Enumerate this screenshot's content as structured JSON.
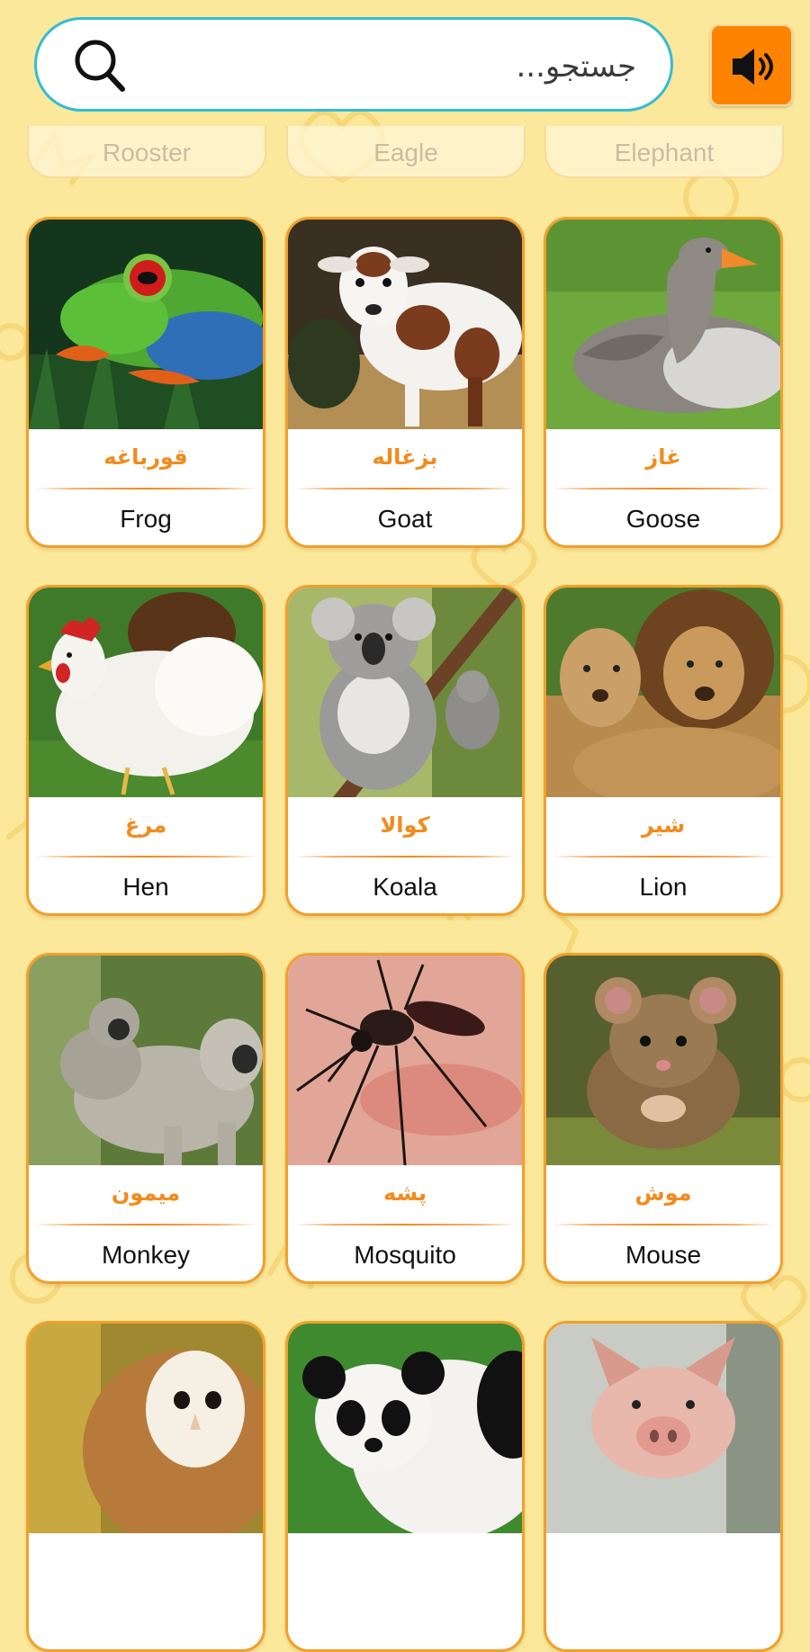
{
  "search": {
    "placeholder": "جستجو..."
  },
  "sound": {
    "icon": "speaker-icon",
    "bg": "#fd8300"
  },
  "colors": {
    "background": "#fbe89a",
    "accent": "#f38a1c",
    "search_border": "#33bcd6"
  },
  "faded_row": [
    "Rooster",
    "Eagle",
    "Elephant"
  ],
  "animals": [
    {
      "fa": "قورباغه",
      "en": "Frog",
      "image": "frog-image"
    },
    {
      "fa": "بزغاله",
      "en": "Goat",
      "image": "goat-image"
    },
    {
      "fa": "غاز",
      "en": "Goose",
      "image": "goose-image"
    },
    {
      "fa": "مرغ",
      "en": "Hen",
      "image": "hen-image"
    },
    {
      "fa": "کوالا",
      "en": "Koala",
      "image": "koala-image"
    },
    {
      "fa": "شیر",
      "en": "Lion",
      "image": "lion-image"
    },
    {
      "fa": "میمون",
      "en": "Monkey",
      "image": "monkey-image"
    },
    {
      "fa": "پشه",
      "en": "Mosquito",
      "image": "mosquito-image"
    },
    {
      "fa": "موش",
      "en": "Mouse",
      "image": "mouse-image"
    },
    {
      "image": "owl-image"
    },
    {
      "image": "panda-image"
    },
    {
      "image": "pig-image"
    }
  ]
}
